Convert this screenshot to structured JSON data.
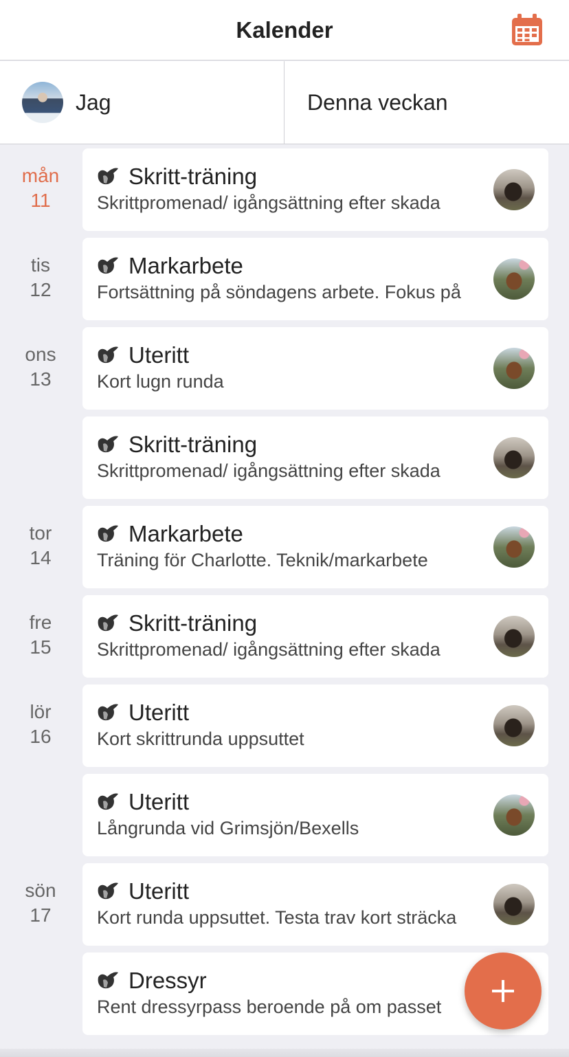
{
  "header": {
    "title": "Kalender",
    "calendar_icon": "calendar-icon"
  },
  "filters": {
    "person": "Jag",
    "period": "Denna veckan"
  },
  "colors": {
    "accent": "#e36e4b",
    "background": "#efeff4"
  },
  "days": [
    {
      "weekday": "mån",
      "date": "11",
      "today": true
    },
    {
      "weekday": "tis",
      "date": "12"
    },
    {
      "weekday": "ons",
      "date": "13"
    },
    {
      "weekday": "tor",
      "date": "14"
    },
    {
      "weekday": "fre",
      "date": "15"
    },
    {
      "weekday": "lör",
      "date": "16"
    },
    {
      "weekday": "sön",
      "date": "17"
    }
  ],
  "events": [
    {
      "title": "Skritt-träning",
      "description": "Skrittpromenad/ igångsättning efter skada",
      "horse": "dark"
    },
    {
      "title": "Markarbete",
      "description": "Fortsättning på söndagens arbete. Fokus på",
      "horse": "brown"
    },
    {
      "title": "Uteritt",
      "description": "Kort lugn runda",
      "horse": "brown"
    },
    {
      "title": "Skritt-träning",
      "description": "Skrittpromenad/ igångsättning efter skada",
      "horse": "dark"
    },
    {
      "title": "Markarbete",
      "description": "Träning för Charlotte. Teknik/markarbete",
      "horse": "brown"
    },
    {
      "title": "Skritt-träning",
      "description": "Skrittpromenad/ igångsättning efter skada",
      "horse": "dark"
    },
    {
      "title": "Uteritt",
      "description": "Kort skrittrunda uppsuttet",
      "horse": "dark"
    },
    {
      "title": "Uteritt",
      "description": "Långrunda vid Grimsjön/Bexells",
      "horse": "brown"
    },
    {
      "title": "Uteritt",
      "description": "Kort runda uppsuttet. Testa trav kort sträcka",
      "horse": "dark"
    },
    {
      "title": "Dressyr",
      "description": "Rent dressyrpass beroende på om passet",
      "horse": ""
    }
  ],
  "fab": {
    "icon": "plus-icon"
  }
}
